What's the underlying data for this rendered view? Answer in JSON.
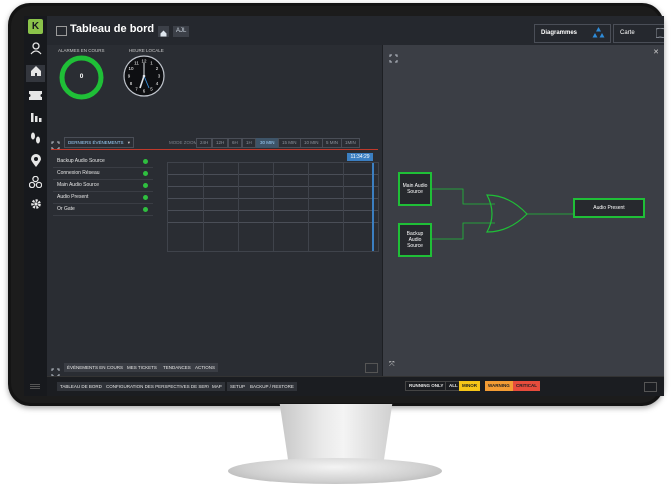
{
  "app": {
    "title": "Tableau de bord",
    "breadcrumb": [
      "AJL"
    ],
    "diagrams_label": "Diagrammes",
    "map_label": "Carte",
    "accent_color": "#1fbf37",
    "alert_color": "#c0392b"
  },
  "sidebar": {
    "icons": [
      "logo-icon",
      "user-icon",
      "home-icon",
      "ticket-icon",
      "chart-icon",
      "footsteps-icon",
      "pin-icon",
      "network-icon",
      "gear-icon"
    ]
  },
  "widgets": {
    "alarms_title": "ALARMES EN COURS",
    "alarms_count": "0",
    "clock_title": "HEURE LOCALE",
    "clock_numbers": [
      "12",
      "1",
      "2",
      "3",
      "4",
      "5",
      "6",
      "7",
      "8",
      "9",
      "10",
      "11"
    ]
  },
  "events": {
    "dropdown_label": "DERNIERS ÉVÉNEMENTS",
    "zoom_label": "MODE ZOOM",
    "zoom_options": [
      "24H",
      "12H",
      "6H",
      "1H",
      "30 MIN",
      "15 MIN",
      "10 MIN",
      "5 MIN",
      "1MIN"
    ],
    "active_zoom": "30 MIN",
    "current_time": "11:34:29",
    "rows": [
      "Backup Audio Source",
      "Connexion Réseau",
      "Main Audio Source",
      "Audio Present",
      "Or Gate"
    ]
  },
  "bottom_tabs": {
    "panel_tabs": [
      "ÉVÉNEMENTS EN COURS",
      "MES TICKETS",
      "TENDANCES",
      "ACTIONS"
    ],
    "nav_tabs": [
      "TABLEAU DE BORD",
      "CONFIGURATION DES PERSPECTIVES DE SERVICE",
      "MAP",
      "SETUP",
      "BACKUP / RESTORE"
    ],
    "severity_filters": [
      "RUNNING ONLY",
      "ALL",
      "MINOR",
      "WARNING",
      "CRITICAL"
    ],
    "severity_colors": {
      "MINOR": "#f5c518",
      "WARNING": "#f39c34",
      "CRITICAL": "#e74c3c"
    }
  },
  "diagram": {
    "nodes": {
      "main": "Main Audio Source",
      "backup": "Backup Audio Source",
      "output": "Audio Present"
    }
  }
}
